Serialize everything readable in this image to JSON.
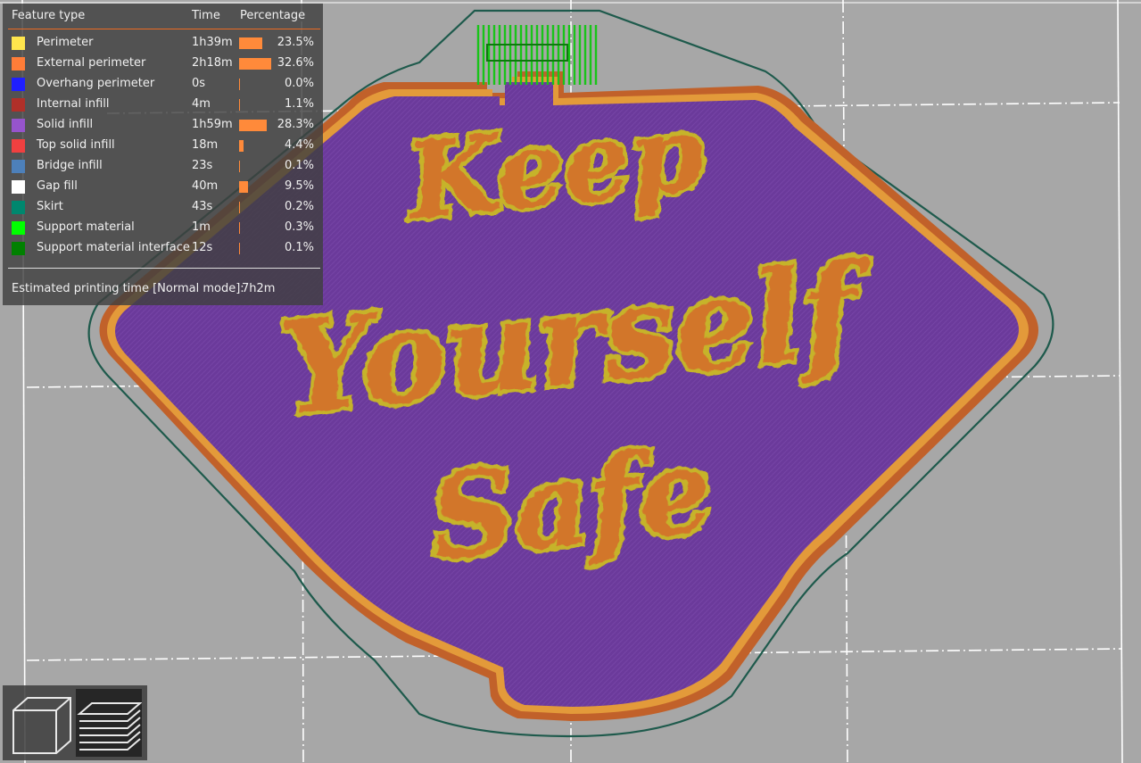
{
  "legend": {
    "headers": {
      "feature": "Feature type",
      "time": "Time",
      "percentage": "Percentage"
    },
    "rows": [
      {
        "name": "Perimeter",
        "time": "1h39m",
        "percent": "23.5%",
        "fraction": 0.235,
        "color": "#ffe64d"
      },
      {
        "name": "External perimeter",
        "time": "2h18m",
        "percent": "32.6%",
        "fraction": 0.326,
        "color": "#ff7d38"
      },
      {
        "name": "Overhang perimeter",
        "time": "0s",
        "percent": "0.0%",
        "fraction": 0.0,
        "color": "#1f1fff"
      },
      {
        "name": "Internal infill",
        "time": "4m",
        "percent": "1.1%",
        "fraction": 0.011,
        "color": "#b03029"
      },
      {
        "name": "Solid infill",
        "time": "1h59m",
        "percent": "28.3%",
        "fraction": 0.283,
        "color": "#9654cc"
      },
      {
        "name": "Top solid infill",
        "time": "18m",
        "percent": "4.4%",
        "fraction": 0.044,
        "color": "#f04040"
      },
      {
        "name": "Bridge infill",
        "time": "23s",
        "percent": "0.1%",
        "fraction": 0.001,
        "color": "#4d80ba"
      },
      {
        "name": "Gap fill",
        "time": "40m",
        "percent": "9.5%",
        "fraction": 0.095,
        "color": "#ffffff"
      },
      {
        "name": "Skirt",
        "time": "43s",
        "percent": "0.2%",
        "fraction": 0.002,
        "color": "#00876e"
      },
      {
        "name": "Support material",
        "time": "1m",
        "percent": "0.3%",
        "fraction": 0.003,
        "color": "#00ff00"
      },
      {
        "name": "Support material interface",
        "time": "12s",
        "percent": "0.1%",
        "fraction": 0.001,
        "color": "#008000"
      }
    ],
    "estimated_label": "Estimated printing time [Normal mode]:",
    "estimated_value": "7h2m"
  },
  "model": {
    "text_lines": [
      "Keep",
      "Yourself",
      "Safe"
    ],
    "colors": {
      "bed": "#a7a7a7",
      "grid": "#ffffff",
      "skirt": "#1e5a4c",
      "solid_infill": "#6a3a9a",
      "external_perimeter": "#e07a30",
      "perimeter": "#c9b022",
      "support": "#19c419"
    }
  },
  "view_toggle": {
    "buttons": [
      {
        "name": "3d-view",
        "icon": "cube-icon",
        "active": false
      },
      {
        "name": "preview",
        "icon": "layers-icon",
        "active": true
      }
    ]
  }
}
